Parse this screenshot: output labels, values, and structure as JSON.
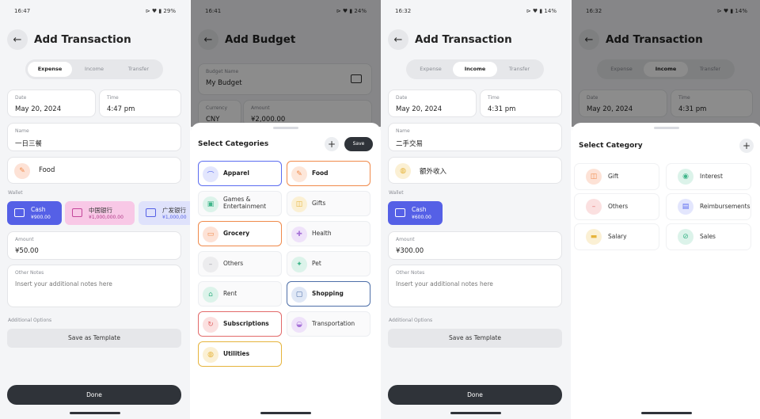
{
  "screen1": {
    "status": {
      "time": "16:47",
      "right": "⊳ ♥ ▮ 29%"
    },
    "title": "Add Transaction",
    "tabs": [
      "Expense",
      "Income",
      "Transfer"
    ],
    "date": {
      "label": "Date",
      "value": "May 20, 2024"
    },
    "time": {
      "label": "Time",
      "value": "4:47 pm"
    },
    "name": {
      "label": "Name",
      "value": "一日三餐"
    },
    "category": "Food",
    "wallet_label": "Wallet",
    "wallets": [
      {
        "name": "Cash",
        "amount": "¥900.00"
      },
      {
        "name": "中国银行",
        "amount": "¥1,000,000.00"
      },
      {
        "name": "广发银行",
        "amount": "¥1,000,00"
      }
    ],
    "amount": {
      "label": "Amount",
      "value": "¥50.00"
    },
    "notes": {
      "label": "Other Notes",
      "placeholder": "Insert your additional notes here"
    },
    "additional_label": "Additional Options",
    "save_template": "Save as Template",
    "done": "Done"
  },
  "screen2": {
    "status": {
      "time": "16:41",
      "right": "⊳ ♥ ▮ 24%"
    },
    "title": "Add Budget",
    "budget_name": {
      "label": "Budget Name",
      "value": "My Budget"
    },
    "currency": {
      "label": "Currency",
      "value": "CNY"
    },
    "amount": {
      "label": "Amount",
      "value": "¥2,000.00"
    },
    "sheet_title": "Select Categories",
    "save": "Save",
    "categories": [
      {
        "name": "Apparel",
        "icon": "hanger-icon",
        "selected": true,
        "color": "#5b6cf0",
        "bg": "#e3e6fd"
      },
      {
        "name": "Food",
        "icon": "food-icon",
        "selected": true,
        "color": "#f08a4b",
        "bg": "#fde7da"
      },
      {
        "name": "Games & Entertainment",
        "icon": "gamepad-icon",
        "selected": false,
        "color": "#3fb58a",
        "bg": "#dcf3ea"
      },
      {
        "name": "Gifts",
        "icon": "gift-icon",
        "selected": false,
        "color": "#e6b43c",
        "bg": "#fbf0d4"
      },
      {
        "name": "Grocery",
        "icon": "cart-icon",
        "selected": true,
        "color": "#f08a4b",
        "bg": "#fde2d6"
      },
      {
        "name": "Health",
        "icon": "health-icon",
        "selected": false,
        "color": "#a773d8",
        "bg": "#efe2fa"
      },
      {
        "name": "Others",
        "icon": "others-icon",
        "selected": false,
        "color": "#9a9ca3",
        "bg": "#ececee"
      },
      {
        "name": "Pet",
        "icon": "pet-icon",
        "selected": false,
        "color": "#3fb58a",
        "bg": "#dcf3ea"
      },
      {
        "name": "Rent",
        "icon": "house-icon",
        "selected": false,
        "color": "#3fb58a",
        "bg": "#dcf3ea"
      },
      {
        "name": "Shopping",
        "icon": "bag-icon",
        "selected": true,
        "color": "#4e6fa8",
        "bg": "#e0e8f6"
      },
      {
        "name": "Subscriptions",
        "icon": "refresh-icon",
        "selected": true,
        "color": "#e26a6a",
        "bg": "#fbe0e0"
      },
      {
        "name": "Transportation",
        "icon": "car-icon",
        "selected": false,
        "color": "#a773d8",
        "bg": "#efe2fa"
      },
      {
        "name": "Utilities",
        "icon": "bulb-icon",
        "selected": true,
        "color": "#e6b43c",
        "bg": "#fbf0d4"
      }
    ]
  },
  "screen3": {
    "status": {
      "time": "16:32",
      "right": "⊳ ♥ ▮ 14%"
    },
    "title": "Add Transaction",
    "tabs": [
      "Expense",
      "Income",
      "Transfer"
    ],
    "date": {
      "label": "Date",
      "value": "May 20, 2024"
    },
    "time": {
      "label": "Time",
      "value": "4:31 pm"
    },
    "name": {
      "label": "Name",
      "value": "二手交易"
    },
    "category": "额外收入",
    "wallet_label": "Wallet",
    "wallets": [
      {
        "name": "Cash",
        "amount": "¥600.00"
      }
    ],
    "amount": {
      "label": "Amount",
      "value": "¥300.00"
    },
    "notes": {
      "label": "Other Notes",
      "placeholder": "Insert your additional notes here"
    },
    "additional_label": "Additional Options",
    "save_template": "Save as Template",
    "done": "Done"
  },
  "screen4": {
    "status": {
      "time": "16:32",
      "right": "⊳ ♥ ▮ 14%"
    },
    "title": "Add Transaction",
    "tabs": [
      "Expense",
      "Income",
      "Transfer"
    ],
    "date": {
      "label": "Date",
      "value": "May 20, 2024"
    },
    "time": {
      "label": "Time",
      "value": "4:31 pm"
    },
    "sheet_title": "Select Category",
    "categories": [
      {
        "name": "Gift",
        "icon": "gift-icon",
        "color": "#f08a4b",
        "bg": "#fde2d6"
      },
      {
        "name": "Interest",
        "icon": "interest-icon",
        "color": "#3fb58a",
        "bg": "#dcf3ea"
      },
      {
        "name": "Others",
        "icon": "others-icon",
        "color": "#e26a6a",
        "bg": "#fbe0e0"
      },
      {
        "name": "Reimbursements",
        "icon": "receipt-icon",
        "color": "#5b6cf0",
        "bg": "#e3e6fd"
      },
      {
        "name": "Salary",
        "icon": "money-icon",
        "color": "#e6b43c",
        "bg": "#fbf0d4"
      },
      {
        "name": "Sales",
        "icon": "tag-icon",
        "color": "#3fb58a",
        "bg": "#dcf3ea"
      }
    ]
  },
  "colors": {
    "wallet_cash": "#5560e6",
    "wallet_pink": "#f8c8e6",
    "wallet_lavender": "#dfe2fb",
    "dark_button": "#2f3339"
  }
}
